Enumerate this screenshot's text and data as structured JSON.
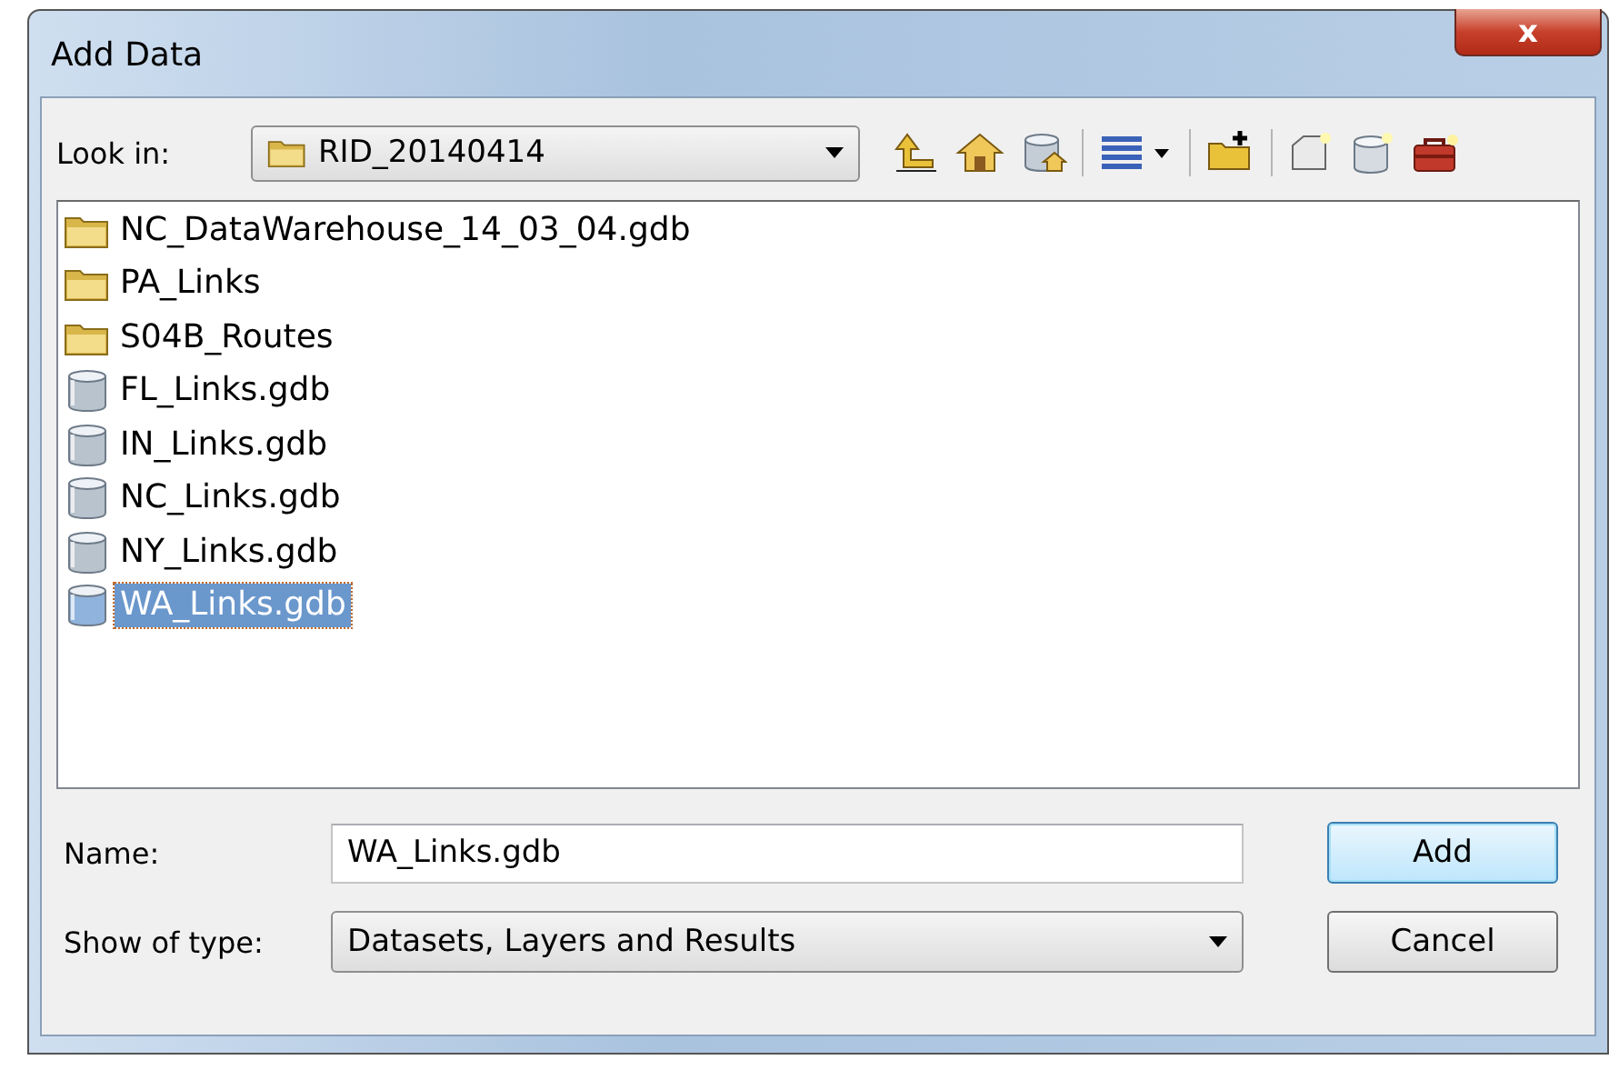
{
  "window": {
    "title": "Add Data",
    "close": "x"
  },
  "look_in": {
    "label": "Look in:",
    "value": "RID_20140414"
  },
  "files": [
    {
      "name": "NC_DataWarehouse_14_03_04.gdb",
      "kind": "folder",
      "selected": false
    },
    {
      "name": "PA_Links",
      "kind": "folder",
      "selected": false
    },
    {
      "name": "S04B_Routes",
      "kind": "folder",
      "selected": false
    },
    {
      "name": "FL_Links.gdb",
      "kind": "database",
      "selected": false
    },
    {
      "name": "IN_Links.gdb",
      "kind": "database",
      "selected": false
    },
    {
      "name": "NC_Links.gdb",
      "kind": "database",
      "selected": false
    },
    {
      "name": "NY_Links.gdb",
      "kind": "database",
      "selected": false
    },
    {
      "name": "WA_Links.gdb",
      "kind": "database",
      "selected": true
    }
  ],
  "name_field": {
    "label": "Name:",
    "value": "WA_Links.gdb"
  },
  "type_field": {
    "label": "Show of type:",
    "value": "Datasets, Layers and Results"
  },
  "buttons": [
    {
      "label": "Add",
      "default": true
    },
    {
      "label": "Cancel",
      "default": false
    }
  ]
}
